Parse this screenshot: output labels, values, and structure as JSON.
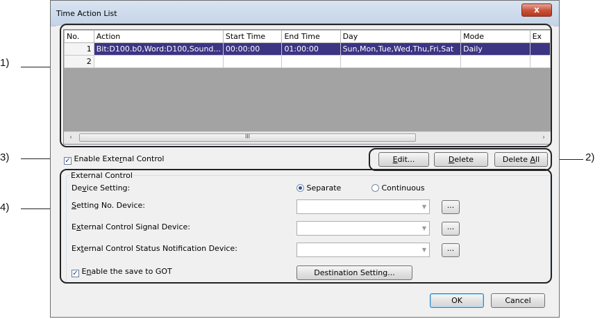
{
  "callouts": {
    "c1": "1)",
    "c2": "2)",
    "c3": "3)",
    "c4": "4)"
  },
  "window": {
    "title": "Time Action List",
    "close_glyph": "x"
  },
  "grid": {
    "columns": [
      "No.",
      "Action",
      "Start Time",
      "End Time",
      "Day",
      "Mode",
      "Ex"
    ],
    "rows": [
      {
        "no": "1",
        "action": "Bit:D100.b0,Word:D100,Sound...",
        "start": "00:00:00",
        "end": "01:00:00",
        "day": "Sun,Mon,Tue,Wed,Thu,Fri,Sat",
        "mode": "Daily",
        "ex": ""
      },
      {
        "no": "2",
        "action": "",
        "start": "",
        "end": "",
        "day": "",
        "mode": "",
        "ex": ""
      }
    ],
    "scroll_left": "‹",
    "scroll_right": "›",
    "thumb_grip": "III"
  },
  "enable_external": {
    "pre": "Enable Exte",
    "ul": "r",
    "post": "nal Control",
    "checked": true
  },
  "buttons": {
    "edit": {
      "ul": "E",
      "post": "dit..."
    },
    "delete": {
      "ul": "D",
      "post": "elete"
    },
    "delete_all": {
      "pre": "Delete ",
      "ul": "A",
      "post": "ll"
    }
  },
  "external_control": {
    "legend": "External Control",
    "device_setting": {
      "pre": "De",
      "ul": "v",
      "post": "ice Setting:"
    },
    "separate": "Separate",
    "continuous": "Continuous",
    "selected": "Separate",
    "setting_no": {
      "pre": "",
      "ul": "S",
      "post": "etting No. Device:"
    },
    "signal": {
      "pre": "E",
      "ul": "x",
      "post": "ternal Control Signal Device:"
    },
    "status": {
      "pre": "Ex",
      "ul": "t",
      "post": "ernal Control Status Notification Device:"
    },
    "save_got": {
      "pre": "E",
      "ul": "n",
      "post": "able the save to GOT",
      "checked": true
    },
    "destination": "Destination Setting...",
    "browse": "..."
  },
  "footer": {
    "ok": "OK",
    "cancel": "Cancel"
  }
}
